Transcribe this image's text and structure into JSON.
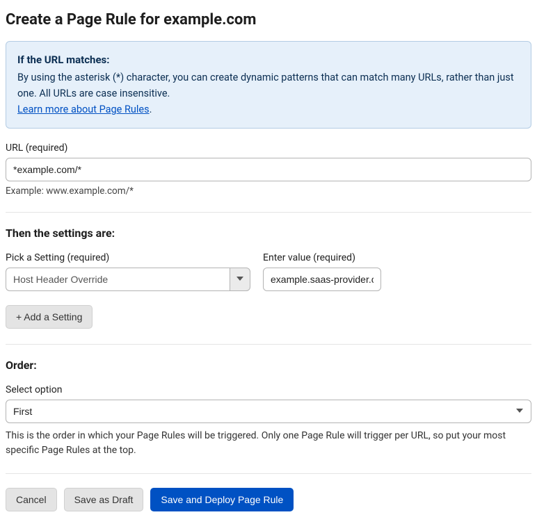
{
  "title": "Create a Page Rule for example.com",
  "info": {
    "title": "If the URL matches:",
    "body": "By using the asterisk (*) character, you can create dynamic patterns that can match many URLs, rather than just one. All URLs are case insensitive.",
    "link_text": "Learn more about Page Rules",
    "period": "."
  },
  "url": {
    "label": "URL (required)",
    "value": "*example.com/*",
    "example": "Example: www.example.com/*"
  },
  "settings": {
    "heading": "Then the settings are:",
    "pick_label": "Pick a Setting (required)",
    "selected_setting": "Host Header Override",
    "value_label": "Enter value (required)",
    "value": "example.saas-provider.com",
    "add_button": "+ Add a Setting"
  },
  "order": {
    "heading": "Order:",
    "label": "Select option",
    "selected": "First",
    "help": "This is the order in which your Page Rules will be triggered. Only one Page Rule will trigger per URL, so put your most specific Page Rules at the top."
  },
  "buttons": {
    "cancel": "Cancel",
    "draft": "Save as Draft",
    "deploy": "Save and Deploy Page Rule"
  }
}
